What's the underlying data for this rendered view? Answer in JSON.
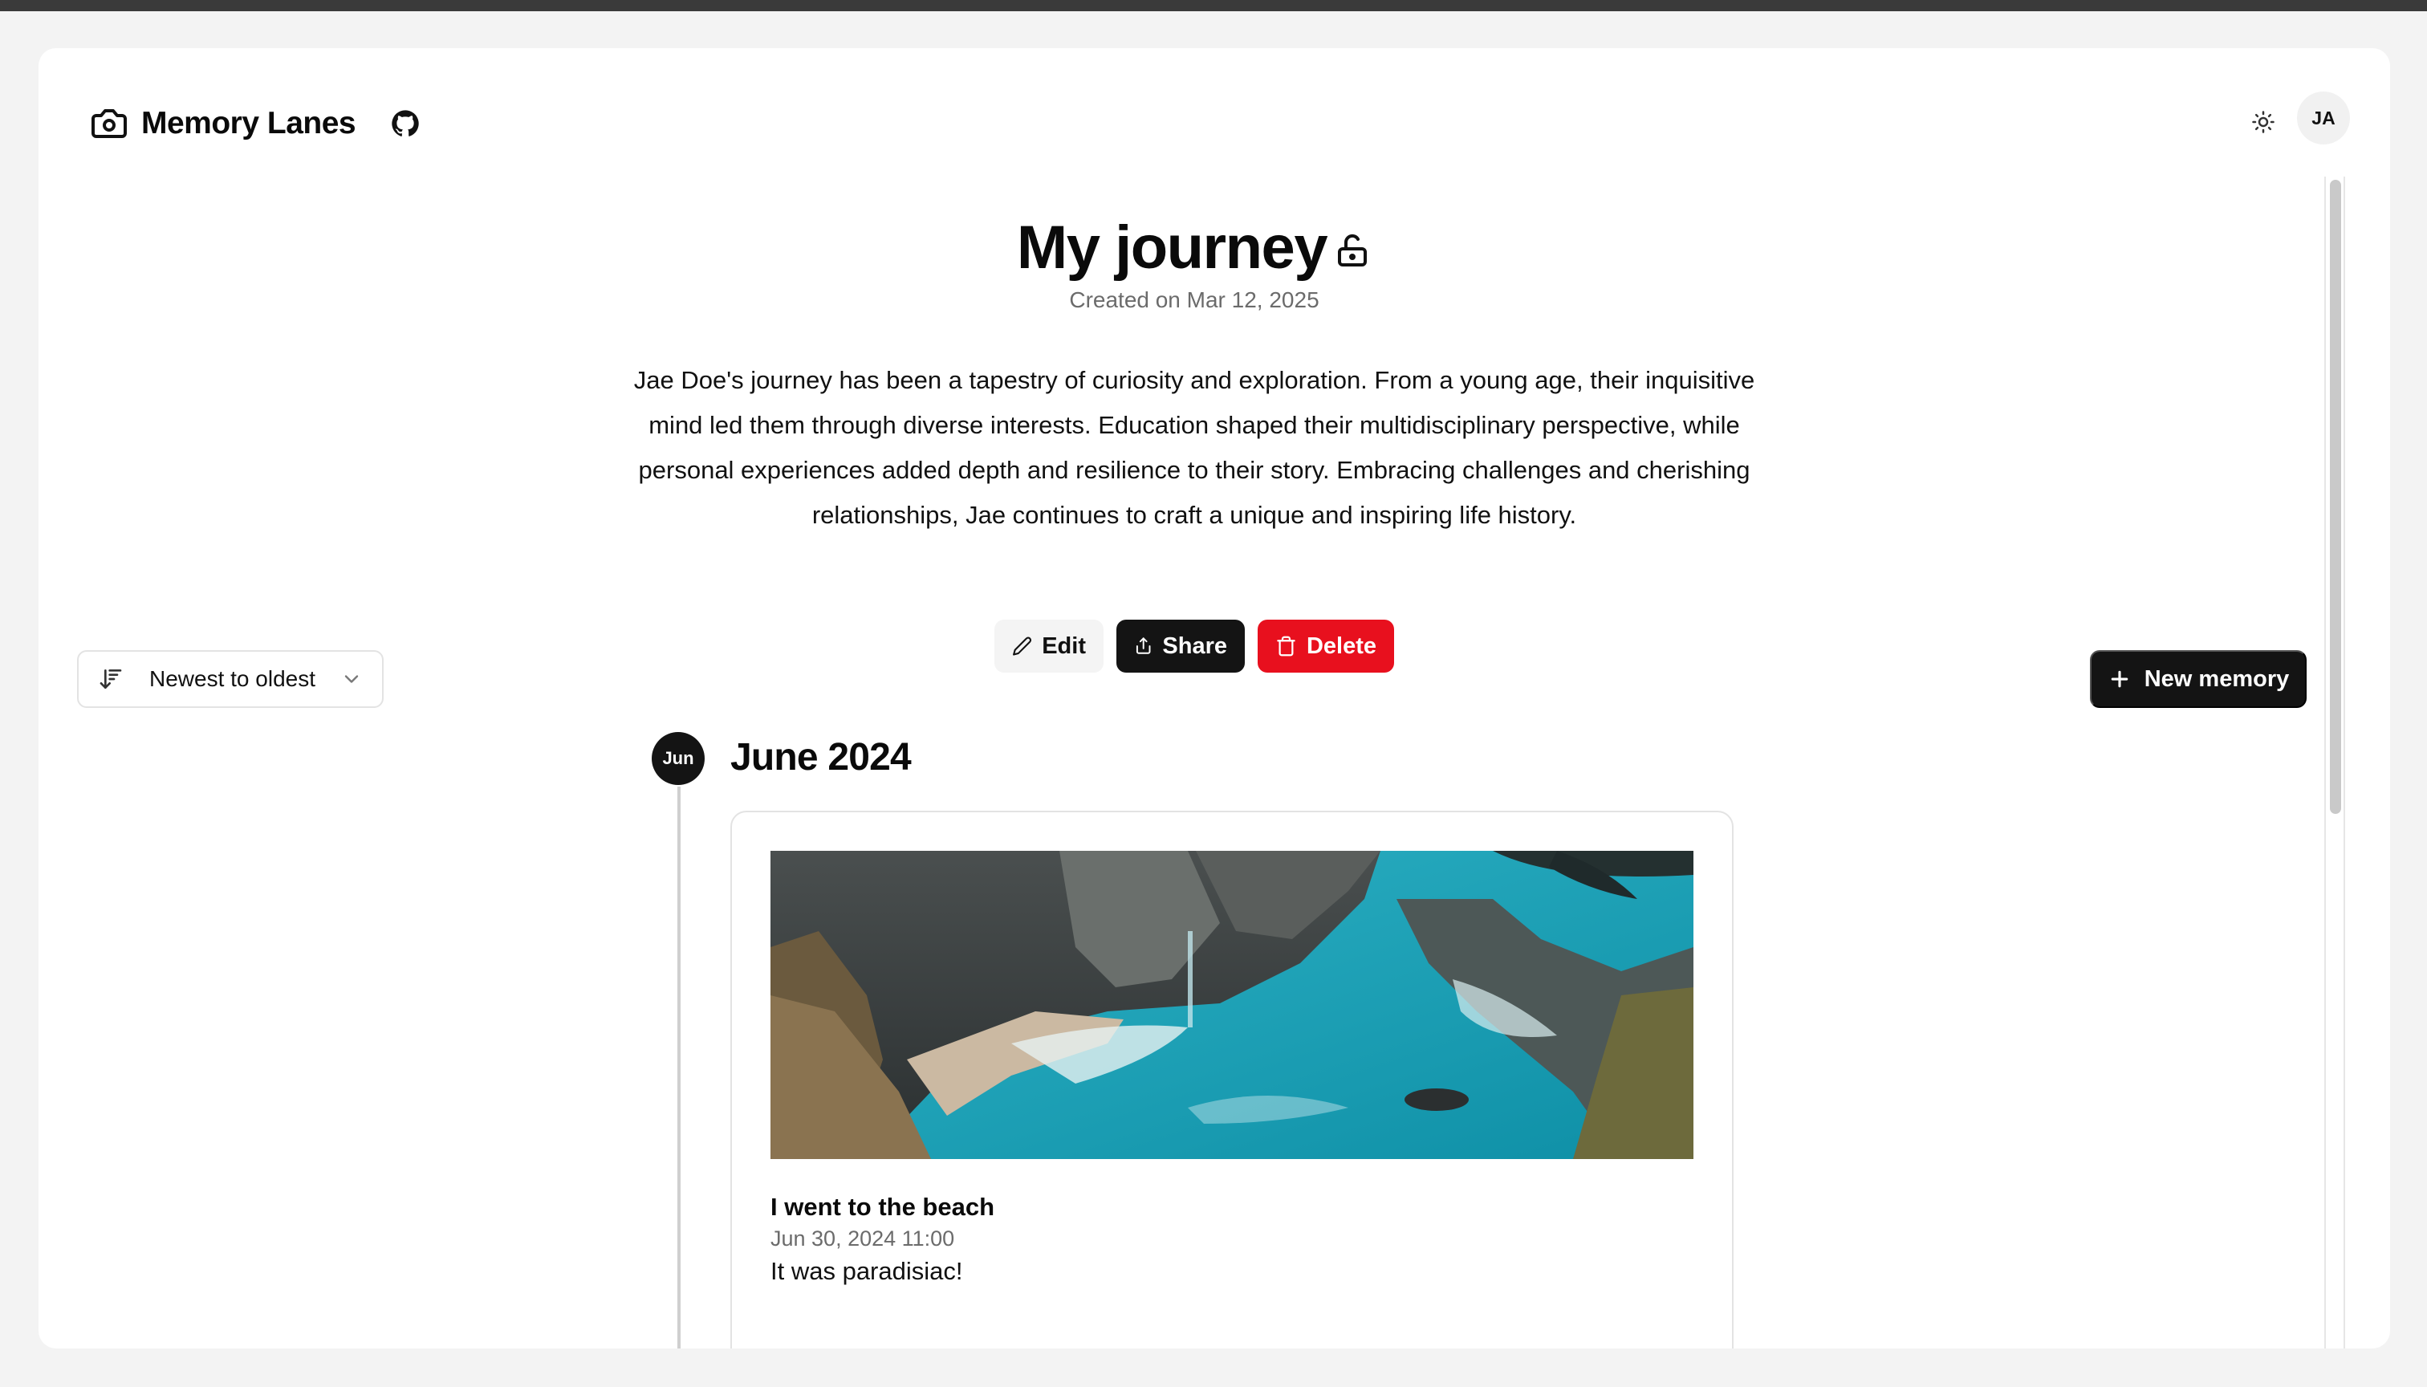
{
  "app": {
    "name": "Memory Lanes",
    "user_initials": "JA"
  },
  "journey": {
    "title": "My journey",
    "created": "Created on Mar 12, 2025",
    "description": "Jae Doe's journey has been a tapestry of curiosity and exploration. From a young age, their inquisitive mind led them through diverse interests. Education shaped their multidisciplinary perspective, while personal experiences added depth and resilience to their story. Embracing challenges and cherishing relationships, Jae continues to craft a unique and inspiring life history."
  },
  "actions": {
    "edit": "Edit",
    "share": "Share",
    "delete": "Delete"
  },
  "toolbar": {
    "sort_label": "Newest to oldest",
    "new_memory": "New memory"
  },
  "timeline": [
    {
      "badge": "Jun",
      "month": "June 2024",
      "memories": [
        {
          "title": "I went to the beach",
          "date": "Jun 30, 2024 11:00",
          "text": "It was paradisiac!"
        }
      ]
    }
  ],
  "icons": [
    "camera-icon",
    "github-icon",
    "sun-icon",
    "unlock-icon",
    "pencil-icon",
    "share-icon",
    "trash-icon",
    "sort-icon",
    "chevron-down-icon",
    "plus-icon"
  ],
  "colors": {
    "primary": "#141414",
    "danger": "#e8101e",
    "muted": "#6b6b6b"
  }
}
